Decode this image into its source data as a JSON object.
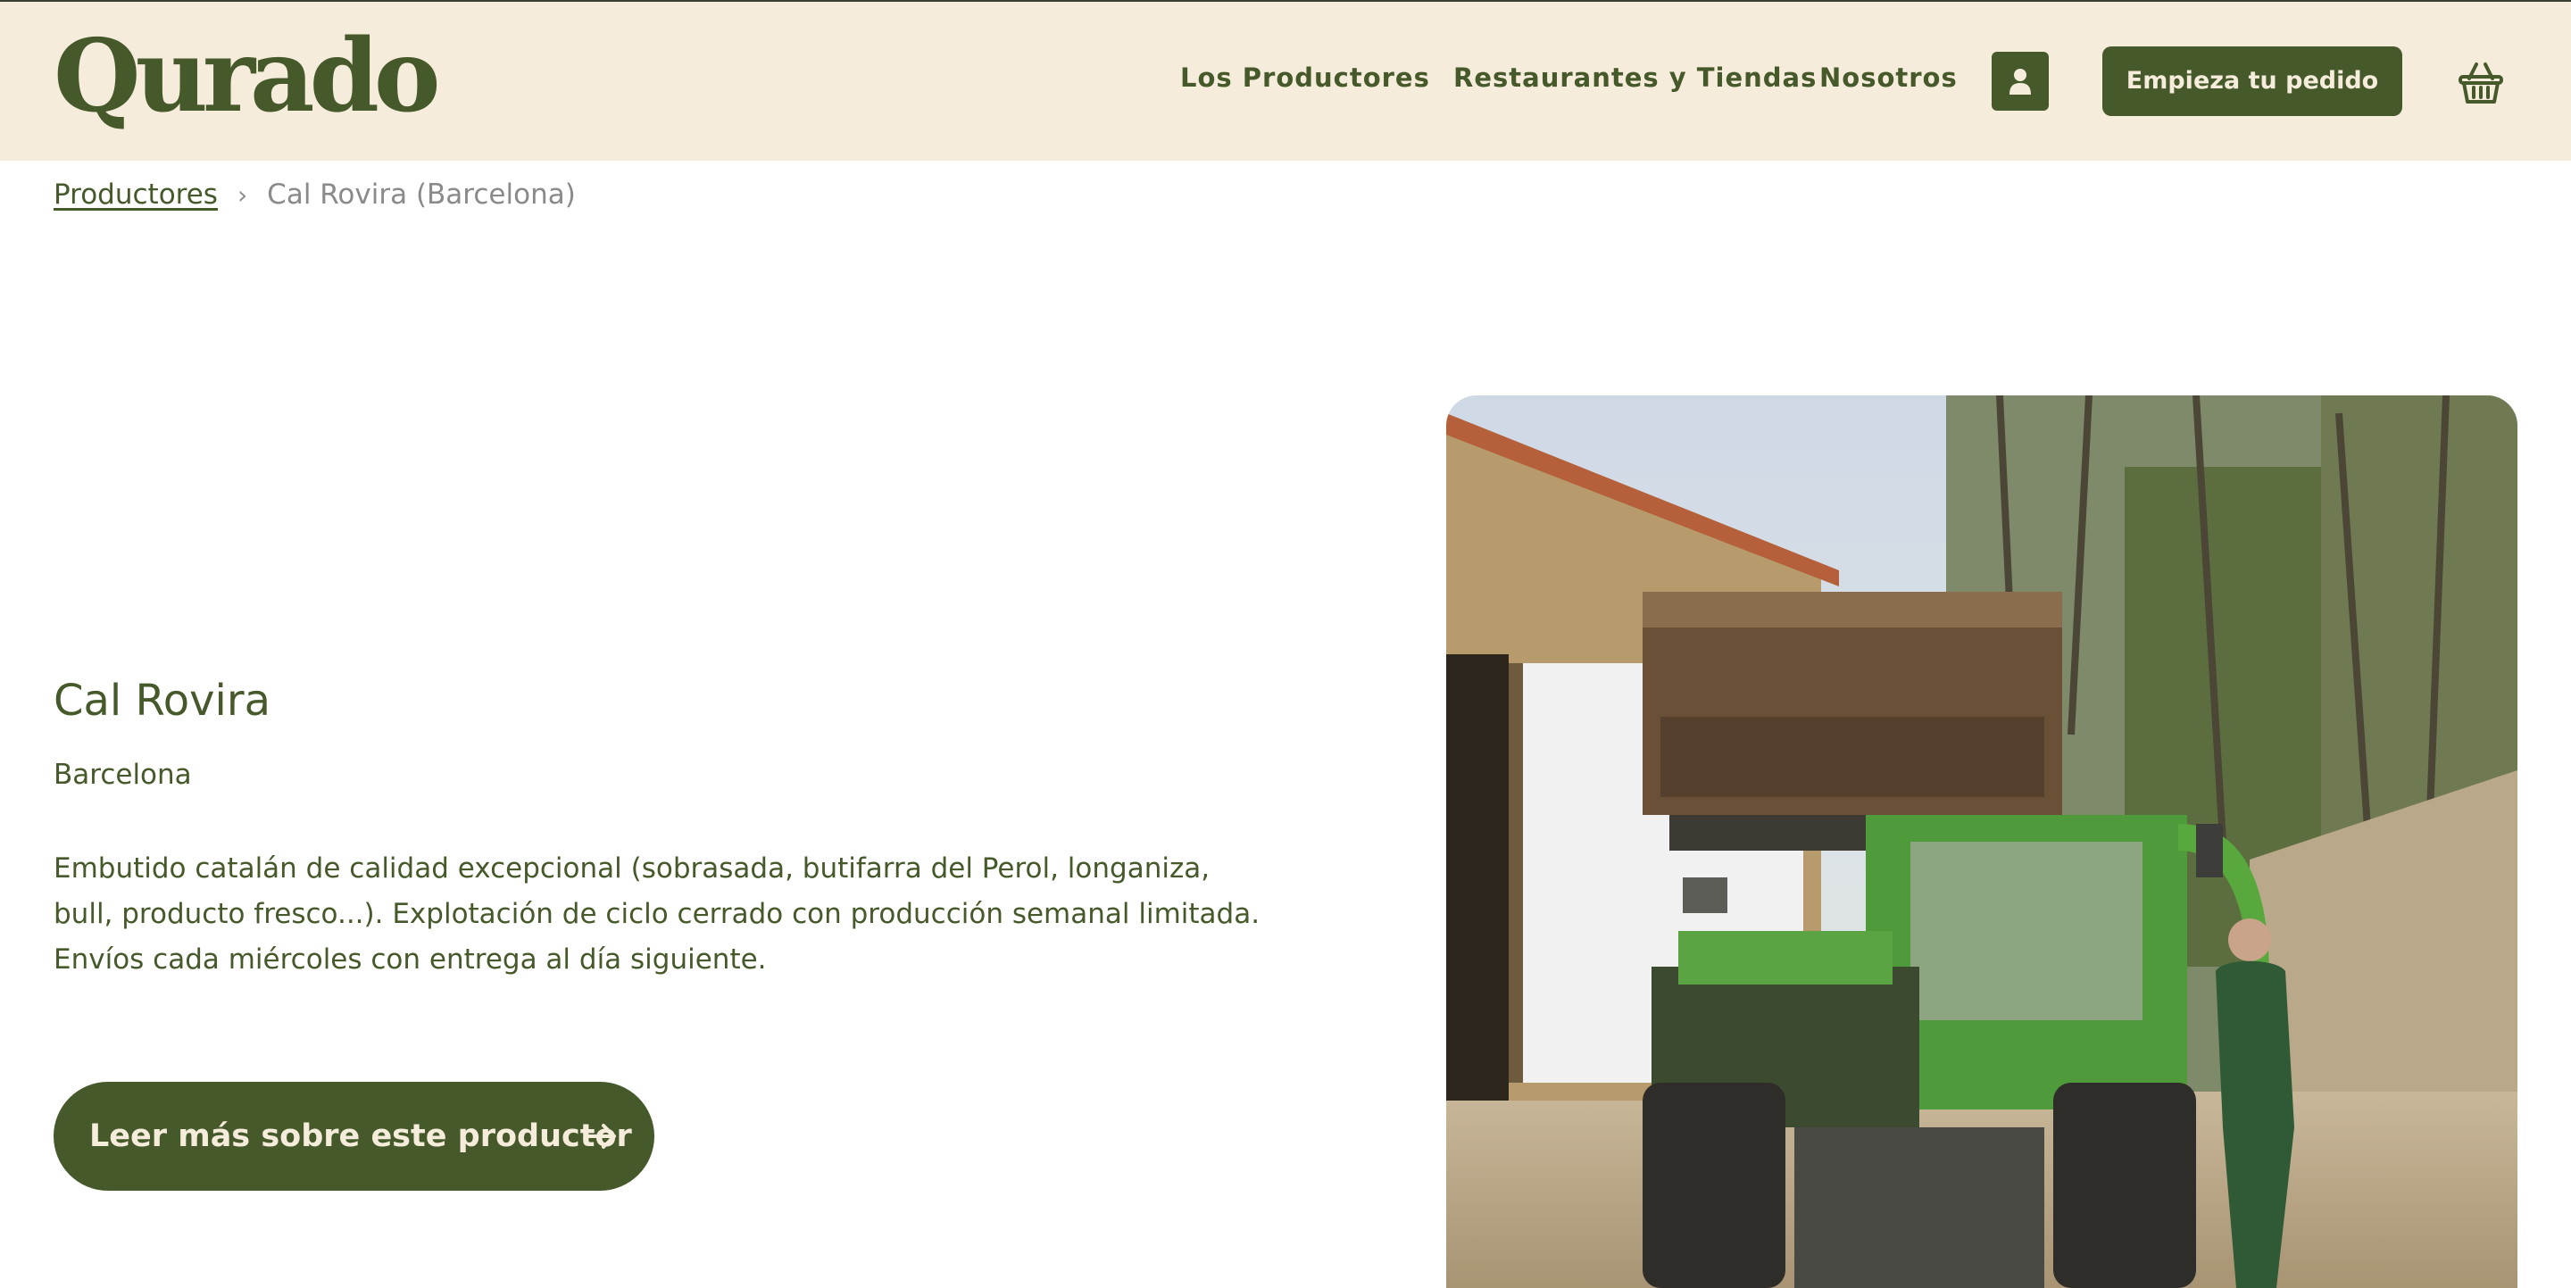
{
  "header": {
    "logo": "Qurado",
    "nav": [
      {
        "label": "Los Productores"
      },
      {
        "label": "Restaurantes y Tiendas"
      },
      {
        "label": "Nosotros"
      }
    ],
    "account_icon": "user-icon",
    "cta_label": "Empieza tu pedido",
    "cart_icon": "basket-icon"
  },
  "breadcrumb": {
    "parent": "Productores",
    "separator": "›",
    "current": "Cal Rovira (Barcelona)"
  },
  "producer": {
    "name": "Cal Rovira",
    "region": "Barcelona",
    "description": "Embutido catalán de calidad excepcional (sobrasada, butifarra del Perol, longaniza, bull, producto fresco...). Explotación de ciclo cerrado con producción semanal limitada. Envíos cada miércoles con entrega al día siguiente.",
    "more_label": "Leer más sobre este productor",
    "more_icon": "arrow-right-icon",
    "photo_icon": "producer-photo"
  },
  "colors": {
    "brand": "#46592a",
    "header_bg": "#f6ecdb",
    "muted_text": "#8a8a8a"
  }
}
